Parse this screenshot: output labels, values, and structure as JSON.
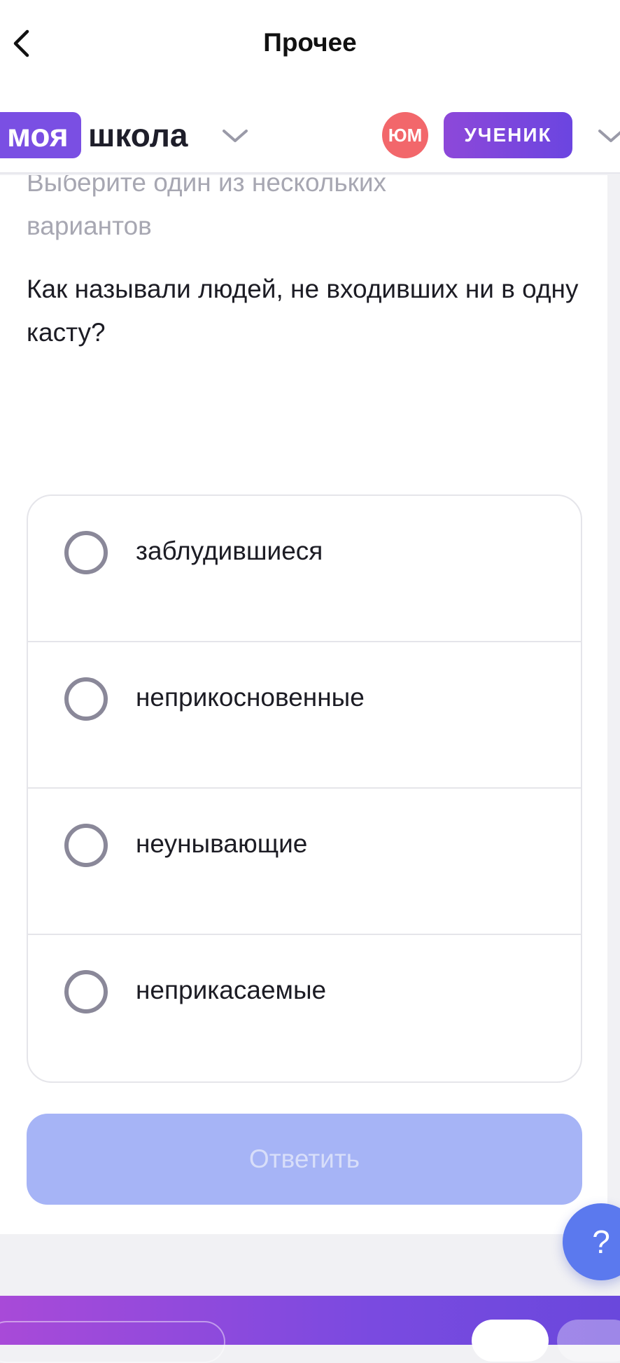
{
  "topbar": {
    "title": "Прочее",
    "back_icon": "chevron-left-icon"
  },
  "school_header": {
    "logo_part1": "моя",
    "logo_part2": "школа",
    "avatar_initials": "ЮМ",
    "role": "УЧЕНИК",
    "colors": {
      "logo_bg": "#7a4fe3",
      "avatar_bg": "#f2676b",
      "role_bg": "#7a48de"
    }
  },
  "quiz": {
    "instruction": "Выберите один из нескольких вариантов",
    "question": "Как называли людей, не входивших ни в одну касту?",
    "options": [
      {
        "label": "заблудившиеся",
        "selected": false
      },
      {
        "label": "неприкосновенные",
        "selected": false
      },
      {
        "label": "неунывающие",
        "selected": false
      },
      {
        "label": "неприкасаемые",
        "selected": false
      }
    ],
    "answer_button": "Ответить",
    "answer_button_color": "#a6b4f6"
  },
  "help": {
    "label": "?"
  }
}
